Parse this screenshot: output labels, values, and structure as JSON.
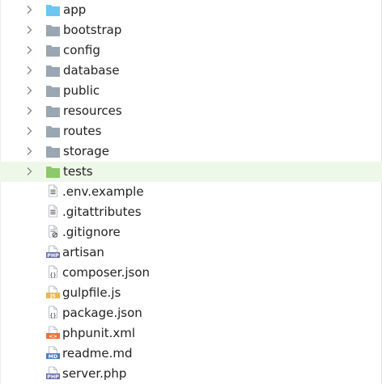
{
  "folders": [
    {
      "label": "app",
      "icon": "folder-blue-icon",
      "color": "#6cc6f2",
      "selected": false
    },
    {
      "label": "bootstrap",
      "icon": "folder-icon",
      "color": "#9aa6b2",
      "selected": false
    },
    {
      "label": "config",
      "icon": "folder-icon",
      "color": "#9aa6b2",
      "selected": false
    },
    {
      "label": "database",
      "icon": "folder-icon",
      "color": "#9aa6b2",
      "selected": false
    },
    {
      "label": "public",
      "icon": "folder-icon",
      "color": "#9aa6b2",
      "selected": false
    },
    {
      "label": "resources",
      "icon": "folder-icon",
      "color": "#9aa6b2",
      "selected": false
    },
    {
      "label": "routes",
      "icon": "folder-icon",
      "color": "#9aa6b2",
      "selected": false
    },
    {
      "label": "storage",
      "icon": "folder-icon",
      "color": "#9aa6b2",
      "selected": false
    },
    {
      "label": "tests",
      "icon": "folder-green-icon",
      "color": "#8bc96b",
      "selected": true
    }
  ],
  "files": [
    {
      "label": ".env.example",
      "icon": "text-file-icon",
      "badge": ""
    },
    {
      "label": ".gitattributes",
      "icon": "text-file-icon",
      "badge": ""
    },
    {
      "label": ".gitignore",
      "icon": "ignore-file-icon",
      "badge": ""
    },
    {
      "label": "artisan",
      "icon": "php-file-icon",
      "badge": "PHP"
    },
    {
      "label": "composer.json",
      "icon": "json-file-icon",
      "badge": "{}"
    },
    {
      "label": "gulpfile.js",
      "icon": "js-file-icon",
      "badge": "JS"
    },
    {
      "label": "package.json",
      "icon": "json-file-icon",
      "badge": "{}"
    },
    {
      "label": "phpunit.xml",
      "icon": "xml-file-icon",
      "badge": "<>"
    },
    {
      "label": "readme.md",
      "icon": "md-file-icon",
      "badge": "MD"
    },
    {
      "label": "server.php",
      "icon": "php-file-icon",
      "badge": "PHP"
    }
  ],
  "colors": {
    "selected_row": "#eef8e8",
    "chevron": "#8a8a8a",
    "file_gray": "#b3b8bf",
    "php_purple": "#6a6fae",
    "js_yellow": "#e8b84a",
    "xml_orange": "#e8743b",
    "md_blue": "#4a7fc1"
  }
}
